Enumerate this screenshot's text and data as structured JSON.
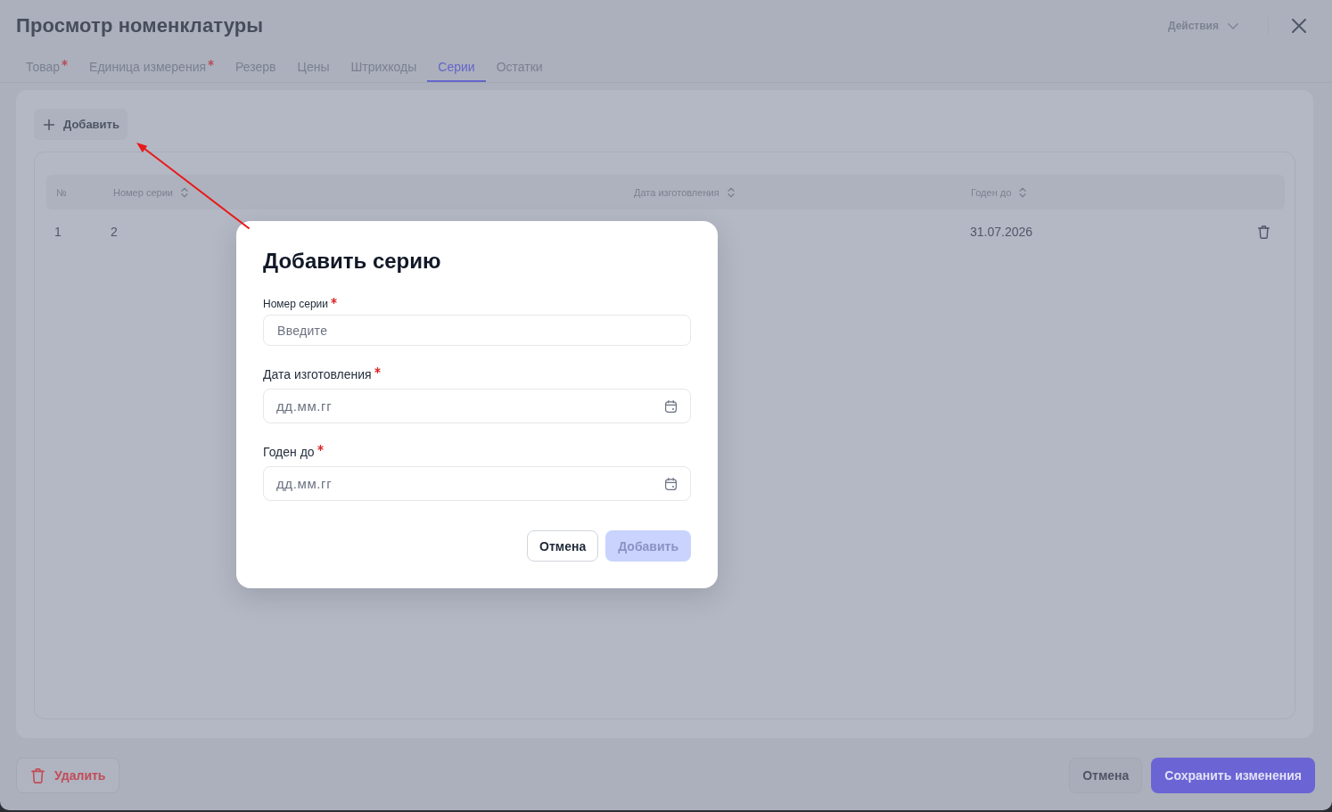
{
  "header": {
    "title": "Просмотр номенклатуры",
    "actions_label": "Действия"
  },
  "tabs": [
    {
      "label": "Товар",
      "required": true,
      "selected": false
    },
    {
      "label": "Единица измерения",
      "required": true,
      "selected": false
    },
    {
      "label": "Резерв",
      "required": false,
      "selected": false
    },
    {
      "label": "Цены",
      "required": false,
      "selected": false
    },
    {
      "label": "Штрихкоды",
      "required": false,
      "selected": false
    },
    {
      "label": "Серии",
      "required": false,
      "selected": true
    },
    {
      "label": "Остатки",
      "required": false,
      "selected": false
    }
  ],
  "series": {
    "add_button": "Добавить",
    "table": {
      "columns": [
        {
          "label": "№",
          "sortable": false
        },
        {
          "label": "Номер серии",
          "sortable": true
        },
        {
          "label": "Дата изготовления",
          "sortable": true
        },
        {
          "label": "Годен до",
          "sortable": true
        }
      ],
      "rows": [
        {
          "number": "1",
          "series_number": "2",
          "expires": "31.07.2026"
        }
      ]
    }
  },
  "footer": {
    "delete_button": "Удалить",
    "cancel_button": "Отмена",
    "save_button": "Сохранить изменения"
  },
  "dialog": {
    "title": "Добавить серию",
    "fields": [
      {
        "kind": "text",
        "label": "Номер серии",
        "required": true,
        "placeholder": "Введите"
      },
      {
        "kind": "date",
        "label": "Дата изготовления",
        "required": true,
        "placeholder": "дд.мм.гг"
      },
      {
        "kind": "date",
        "label": "Годен до",
        "required": true,
        "placeholder": "дд.мм.гг"
      }
    ],
    "cancel_button": "Отмена",
    "submit_button": {
      "label": "Добавить",
      "disabled": true
    }
  }
}
